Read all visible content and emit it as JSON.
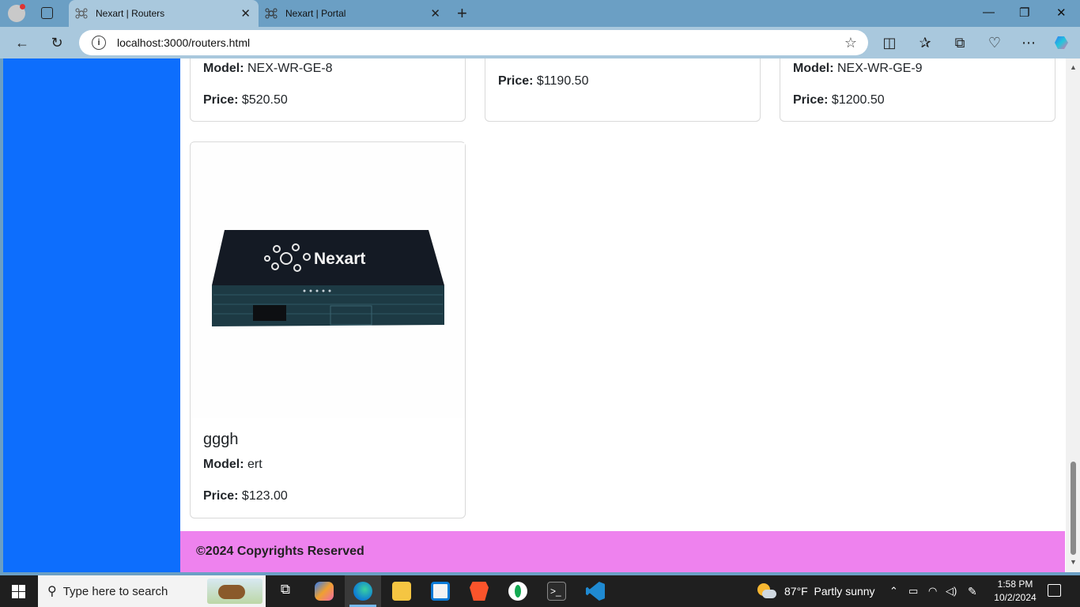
{
  "browser": {
    "tabs": [
      {
        "label": "Nexart | Routers",
        "active": true
      },
      {
        "label": "Nexart | Portal",
        "active": false
      }
    ],
    "address": "localhost:3000/routers.html",
    "window_controls": [
      "minimize",
      "restore",
      "close"
    ]
  },
  "page": {
    "colors": {
      "sidebar": "#0d6efd",
      "footer": "#ee82ee"
    },
    "cards": [
      {
        "model_label": "Model:",
        "model": "NEX-WR-GE-8",
        "price_label": "Price:",
        "price": "$520.50"
      },
      {
        "price_label": "Price:",
        "price": "$1190.50"
      },
      {
        "model_label": "Model:",
        "model": "NEX-WR-GE-9",
        "price_label": "Price:",
        "price": "$1200.50"
      },
      {
        "title": "gggh",
        "model_label": "Model:",
        "model": "ert",
        "price_label": "Price:",
        "price": "$123.00",
        "image_logo": "Nexart"
      }
    ],
    "footer": "©2024 Copyrights Reserved"
  },
  "taskbar": {
    "search_placeholder": "Type here to search",
    "weather": {
      "temp": "87°F",
      "condition": "Partly sunny"
    },
    "time": "1:58 PM",
    "date": "10/2/2024"
  }
}
